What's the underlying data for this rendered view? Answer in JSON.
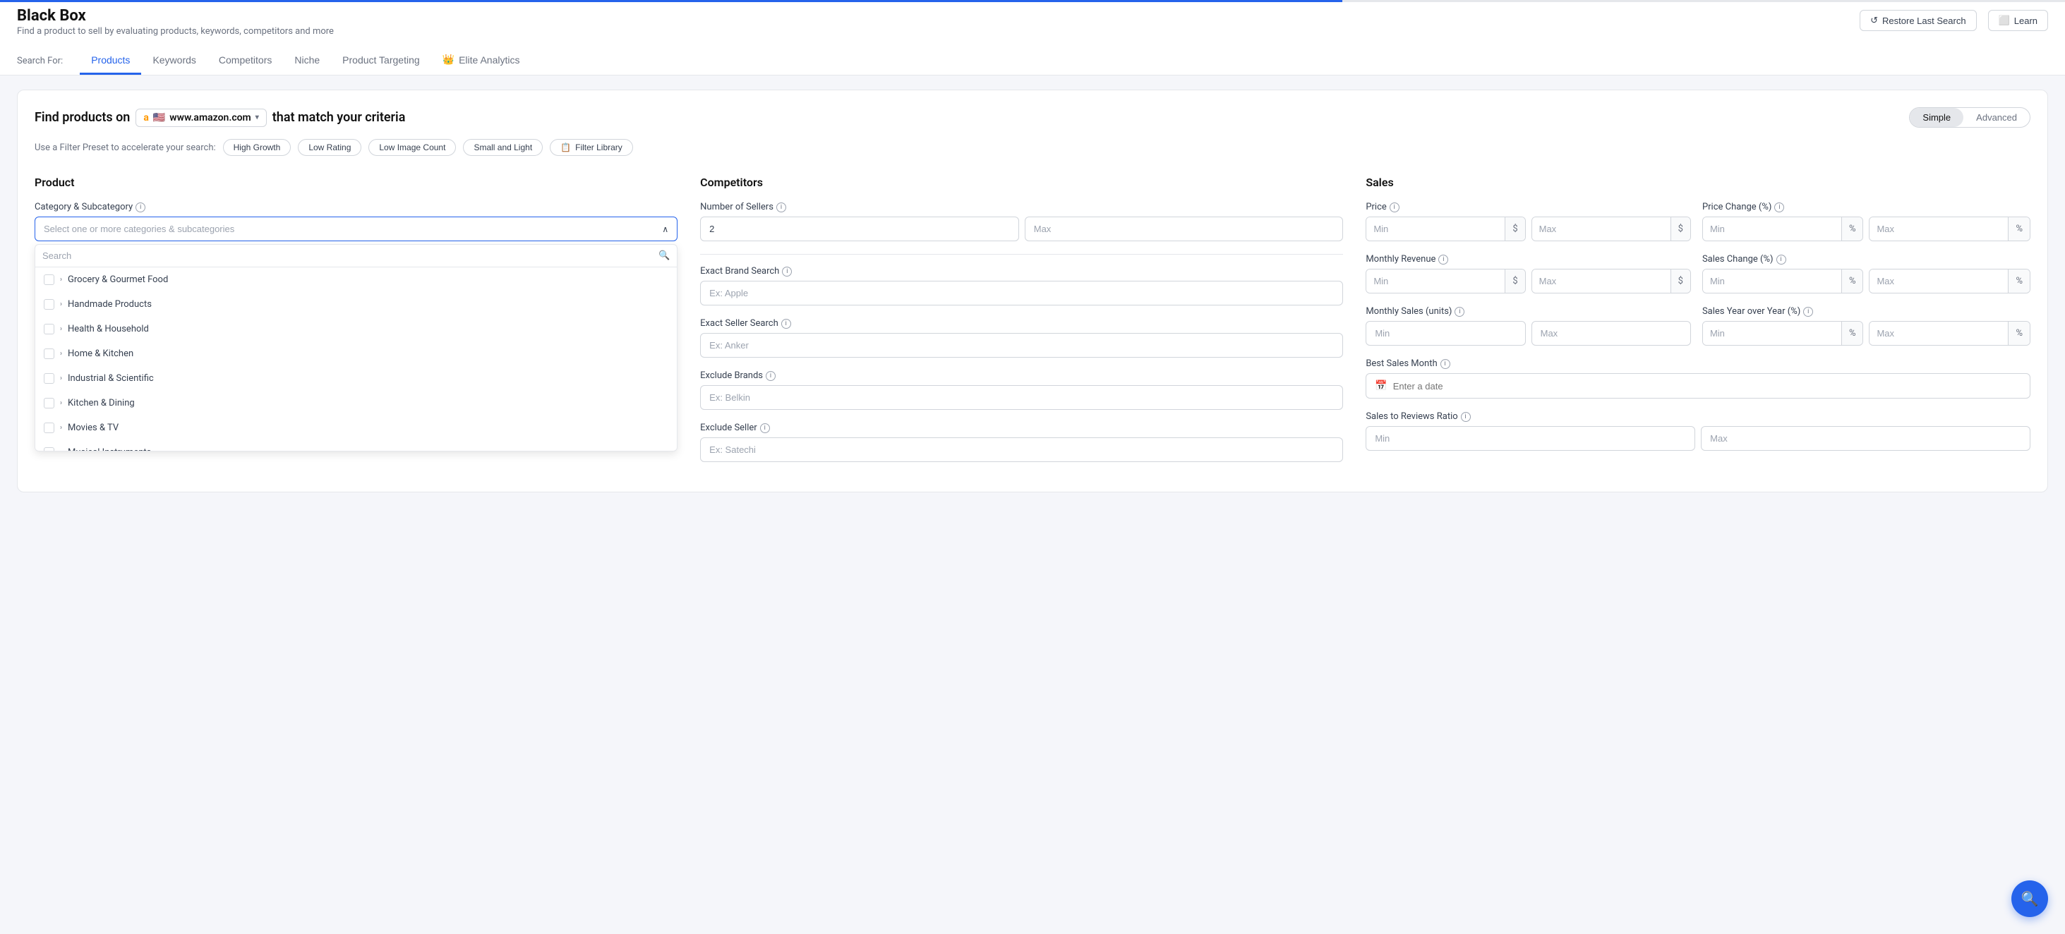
{
  "app": {
    "title": "Black Box",
    "subtitle": "Find a product to sell by evaluating products, keywords, competitors and more"
  },
  "top_actions": {
    "restore_label": "Restore Last Search",
    "learn_label": "Learn"
  },
  "search_for": {
    "label": "Search For:",
    "tabs": [
      {
        "id": "products",
        "label": "Products",
        "active": true
      },
      {
        "id": "keywords",
        "label": "Keywords",
        "active": false
      },
      {
        "id": "competitors",
        "label": "Competitors",
        "active": false
      },
      {
        "id": "niche",
        "label": "Niche",
        "active": false
      },
      {
        "id": "product-targeting",
        "label": "Product Targeting",
        "active": false
      },
      {
        "id": "elite-analytics",
        "label": "Elite Analytics",
        "active": false,
        "has_crown": true
      }
    ]
  },
  "find_products": {
    "prefix": "Find products on",
    "suffix": "that match your criteria",
    "amazon_url": "www.amazon.com",
    "toggle": {
      "simple_label": "Simple",
      "advanced_label": "Advanced",
      "active": "simple"
    }
  },
  "filter_presets": {
    "label": "Use a Filter Preset to accelerate your search:",
    "presets": [
      {
        "id": "high-growth",
        "label": "High Growth"
      },
      {
        "id": "low-rating",
        "label": "Low Rating"
      },
      {
        "id": "low-image-count",
        "label": "Low Image Count"
      },
      {
        "id": "small-and-light",
        "label": "Small and Light"
      }
    ],
    "filter_library_label": "Filter Library"
  },
  "sections": {
    "product": {
      "title": "Product",
      "category_label": "Category & Subcategory",
      "category_placeholder": "Select one or more categories & subcategories",
      "search_placeholder": "Search",
      "categories": [
        {
          "id": "grocery",
          "label": "Grocery & Gourmet Food"
        },
        {
          "id": "handmade",
          "label": "Handmade Products"
        },
        {
          "id": "health",
          "label": "Health & Household"
        },
        {
          "id": "home-kitchen",
          "label": "Home & Kitchen"
        },
        {
          "id": "industrial",
          "label": "Industrial & Scientific"
        },
        {
          "id": "kitchen-dining",
          "label": "Kitchen & Dining"
        },
        {
          "id": "movies-tv",
          "label": "Movies & TV"
        },
        {
          "id": "musical",
          "label": "Musical Instruments"
        }
      ]
    },
    "competitors": {
      "title": "Competitors",
      "number_of_sellers_label": "Number of Sellers",
      "sellers_min_value": "2",
      "sellers_max_placeholder": "Max",
      "exact_brand_search_label": "Exact Brand Search",
      "exact_brand_placeholder": "Ex: Apple",
      "exact_seller_search_label": "Exact Seller Search",
      "exact_seller_placeholder": "Ex: Anker",
      "exclude_brands_label": "Exclude Brands",
      "exclude_brands_placeholder": "Ex: Belkin",
      "exclude_seller_label": "Exclude Seller",
      "exclude_seller_placeholder": "Ex: Satechi"
    },
    "sales": {
      "title": "Sales",
      "price_label": "Price",
      "price_min_placeholder": "Min",
      "price_max_placeholder": "Max",
      "price_change_label": "Price Change (%)",
      "price_change_min_placeholder": "Min",
      "price_change_max_placeholder": "Max",
      "monthly_revenue_label": "Monthly Revenue",
      "monthly_revenue_min_placeholder": "Min",
      "monthly_revenue_max_placeholder": "Max",
      "sales_change_label": "Sales Change (%)",
      "sales_change_min_placeholder": "Min",
      "sales_change_max_placeholder": "Max",
      "monthly_sales_label": "Monthly Sales (units)",
      "monthly_sales_min_placeholder": "Min",
      "monthly_sales_max_placeholder": "Max",
      "sales_yoy_label": "Sales Year over Year (%)",
      "sales_yoy_min_placeholder": "Min",
      "sales_yoy_max_placeholder": "Max",
      "best_sales_month_label": "Best Sales Month",
      "best_sales_date_placeholder": "Enter a date",
      "sales_reviews_ratio_label": "Sales to Reviews Ratio",
      "sales_reviews_min_placeholder": "Min",
      "sales_reviews_max_placeholder": "Max"
    }
  }
}
